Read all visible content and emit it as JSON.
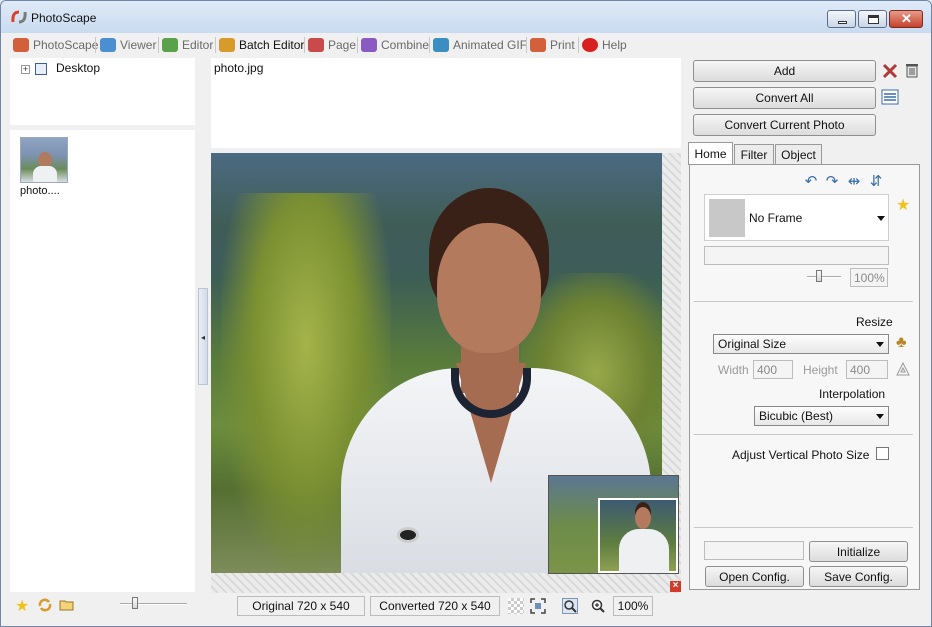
{
  "window": {
    "title": "PhotoScape"
  },
  "tabs": [
    {
      "label": "PhotoScape",
      "icon": "photoscape-icon",
      "color": "#d2603a"
    },
    {
      "label": "Viewer",
      "icon": "viewer-icon",
      "color": "#4c8fd1"
    },
    {
      "label": "Editor",
      "icon": "editor-icon",
      "color": "#5aa24a"
    },
    {
      "label": "Batch Editor",
      "icon": "batch-editor-icon",
      "color": "#d89a2a",
      "active": true
    },
    {
      "label": "Page",
      "icon": "page-icon",
      "color": "#c94a4a"
    },
    {
      "label": "Combine",
      "icon": "combine-icon",
      "color": "#8a5ac2"
    },
    {
      "label": "Animated GIF",
      "icon": "animated-gif-icon",
      "color": "#3a8ec2"
    },
    {
      "label": "Print",
      "icon": "print-icon",
      "color": "#d2603a"
    },
    {
      "label": "Help",
      "icon": "help-icon",
      "color": "#d8201f"
    }
  ],
  "folder_tree": {
    "expander": "+",
    "root_label": "Desktop"
  },
  "file_list": [
    {
      "label": "photo...."
    }
  ],
  "preview": {
    "filename": "photo.jpg"
  },
  "actions": {
    "add": "Add",
    "convert_all": "Convert All",
    "convert_current": "Convert Current Photo"
  },
  "right_tabs": [
    {
      "label": "Home",
      "active": true
    },
    {
      "label": "Filter"
    },
    {
      "label": "Object"
    }
  ],
  "home": {
    "frame": {
      "selected": "No Frame"
    },
    "frame_opacity": "100%",
    "resize": {
      "label": "Resize",
      "mode": "Original Size",
      "width_label": "Width",
      "width_value": "400",
      "height_label": "Height",
      "height_value": "400"
    },
    "interpolation": {
      "label": "Interpolation",
      "selected": "Bicubic (Best)"
    },
    "adjust_vertical_label": "Adjust Vertical Photo Size",
    "adjust_vertical_checked": false,
    "initialize": "Initialize",
    "open_config": "Open Config.",
    "save_config": "Save Config."
  },
  "statusbar": {
    "original": "Original 720 x 540",
    "converted": "Converted 720 x 540",
    "zoom": "100%"
  }
}
